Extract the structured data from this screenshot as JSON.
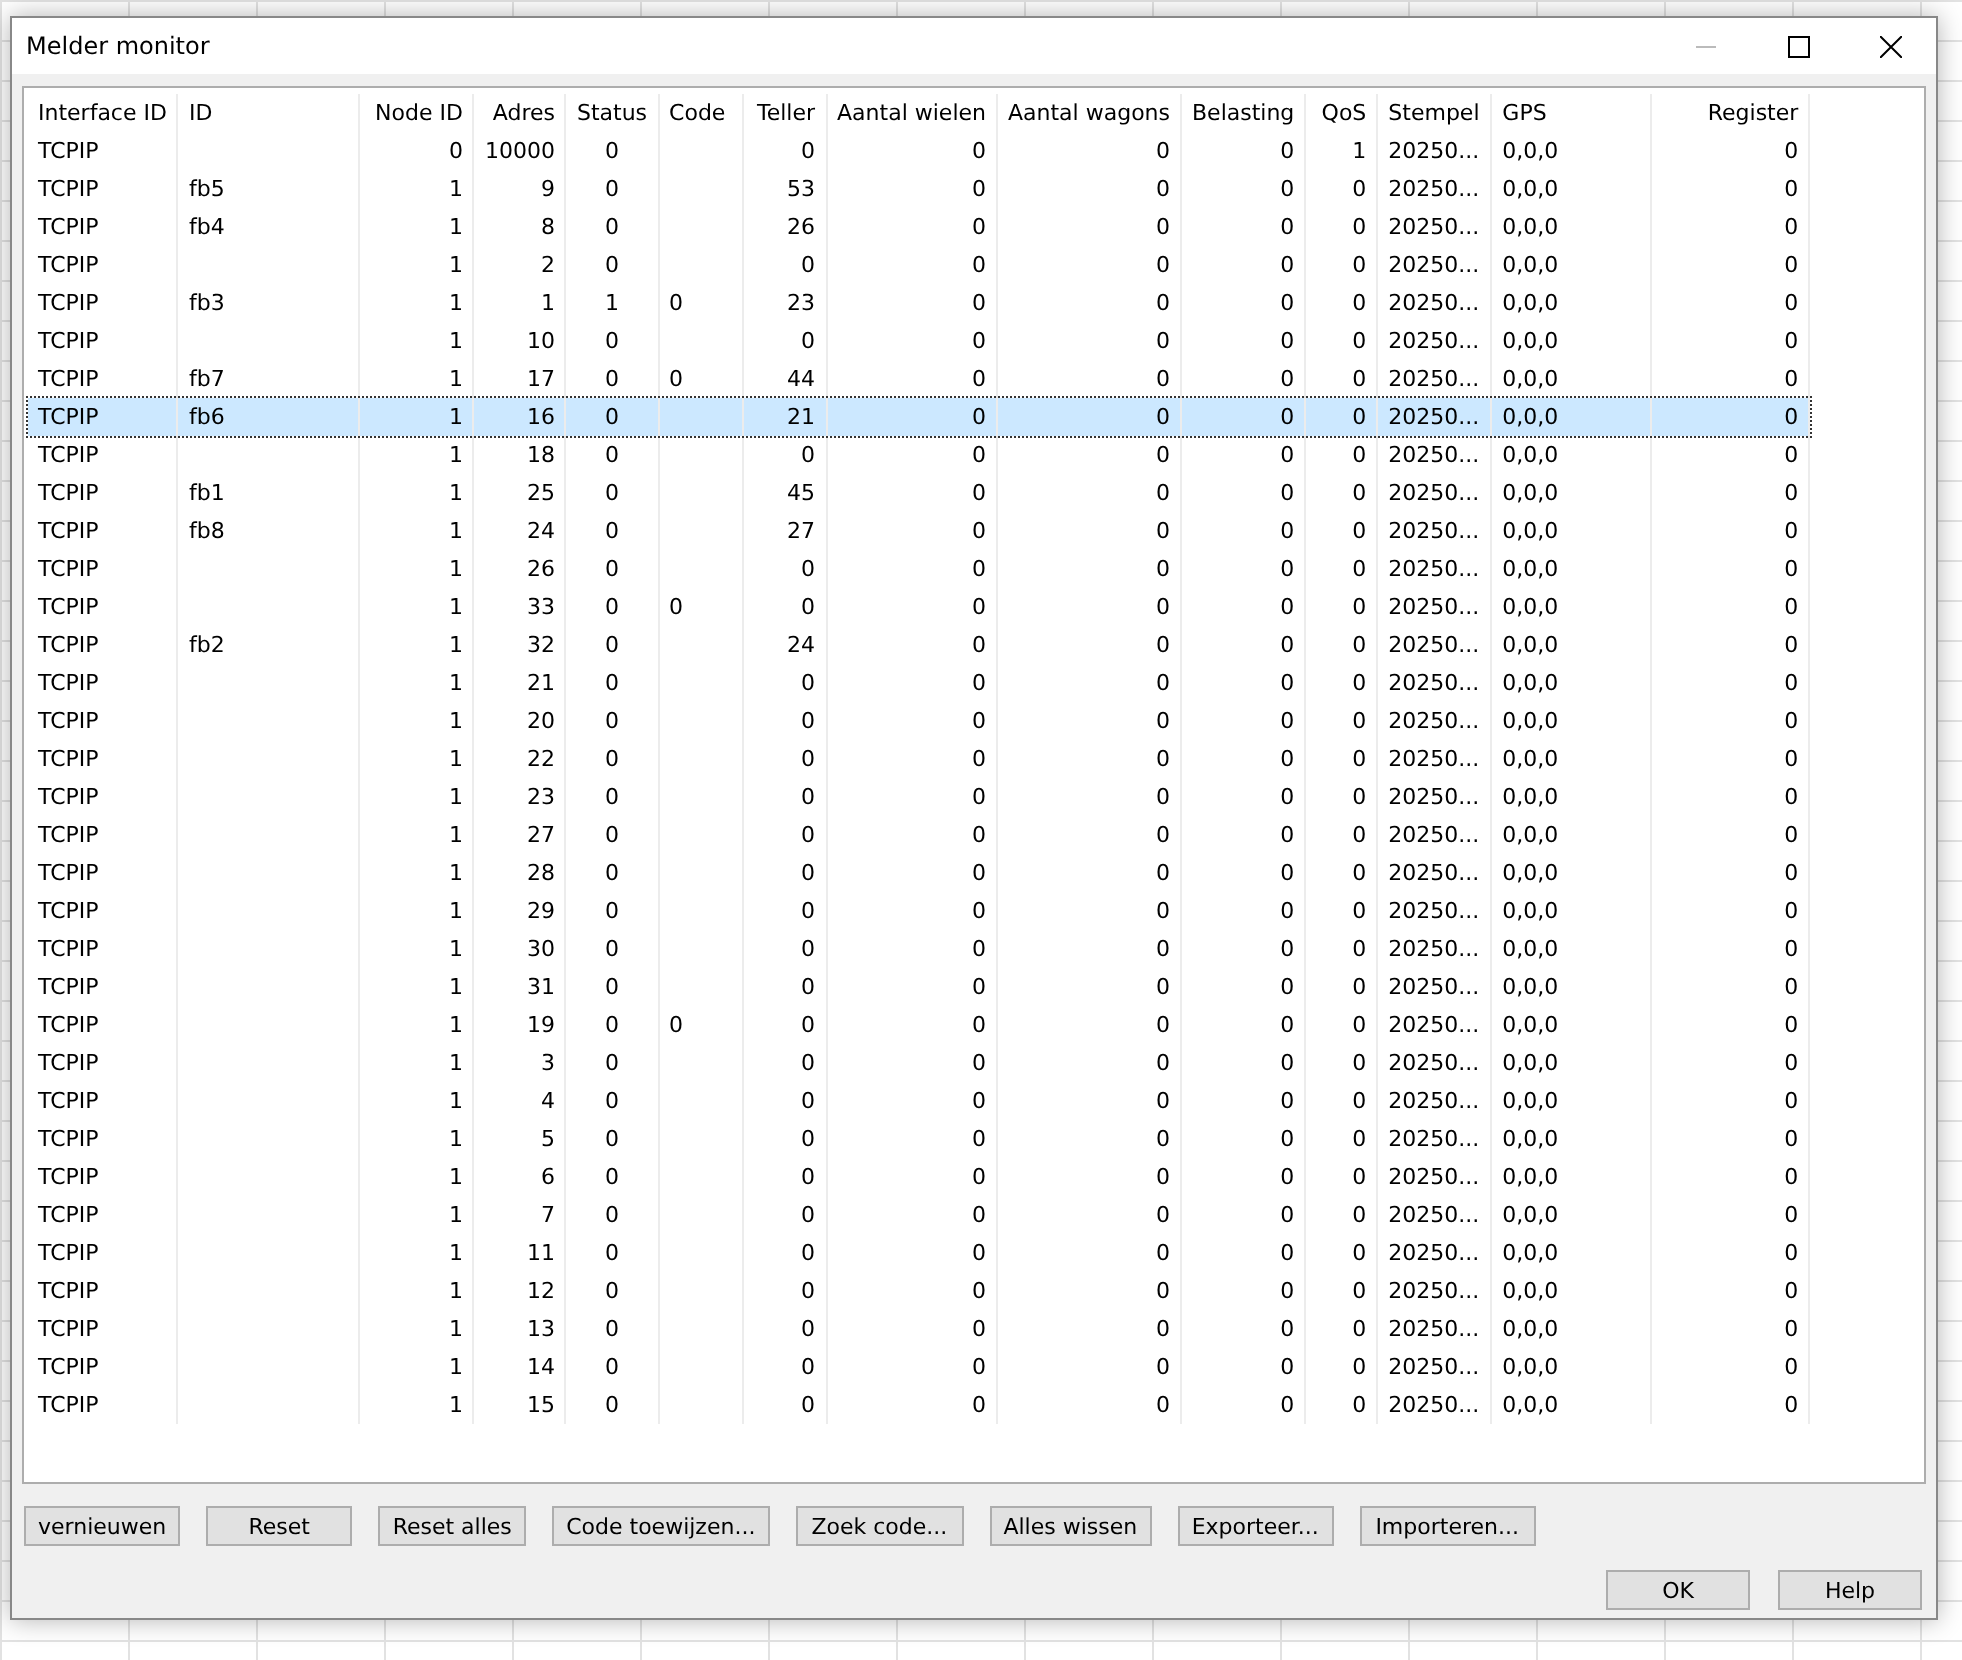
{
  "window": {
    "title": "Melder monitor"
  },
  "table": {
    "columns": [
      "Interface ID",
      "ID",
      "Node ID",
      "Adres",
      "Status",
      "Code",
      "Teller",
      "Aantal wielen",
      "Aantal wagons",
      "Belasting",
      "QoS",
      "Stempel",
      "GPS",
      "Register"
    ],
    "rows": [
      {
        "selected": false,
        "cells": [
          "TCPIP",
          null,
          "0",
          "10000",
          "0",
          null,
          "0",
          "0",
          "0",
          "0",
          "1",
          "20250...",
          "0,0,0",
          "0"
        ]
      },
      {
        "selected": false,
        "cells": [
          "TCPIP",
          "fb5",
          "1",
          "9",
          "0",
          null,
          "53",
          "0",
          "0",
          "0",
          "0",
          "20250...",
          "0,0,0",
          "0"
        ]
      },
      {
        "selected": false,
        "cells": [
          "TCPIP",
          "fb4",
          "1",
          "8",
          "0",
          null,
          "26",
          "0",
          "0",
          "0",
          "0",
          "20250...",
          "0,0,0",
          "0"
        ]
      },
      {
        "selected": false,
        "cells": [
          "TCPIP",
          null,
          "1",
          "2",
          "0",
          null,
          "0",
          "0",
          "0",
          "0",
          "0",
          "20250...",
          "0,0,0",
          "0"
        ]
      },
      {
        "selected": false,
        "cells": [
          "TCPIP",
          "fb3",
          "1",
          "1",
          "1",
          "0",
          "23",
          "0",
          "0",
          "0",
          "0",
          "20250...",
          "0,0,0",
          "0"
        ]
      },
      {
        "selected": false,
        "cells": [
          "TCPIP",
          null,
          "1",
          "10",
          "0",
          null,
          "0",
          "0",
          "0",
          "0",
          "0",
          "20250...",
          "0,0,0",
          "0"
        ]
      },
      {
        "selected": false,
        "cells": [
          "TCPIP",
          "fb7",
          "1",
          "17",
          "0",
          "0",
          "44",
          "0",
          "0",
          "0",
          "0",
          "20250...",
          "0,0,0",
          "0"
        ]
      },
      {
        "selected": true,
        "cells": [
          "TCPIP",
          "fb6",
          "1",
          "16",
          "0",
          null,
          "21",
          "0",
          "0",
          "0",
          "0",
          "20250...",
          "0,0,0",
          "0"
        ]
      },
      {
        "selected": false,
        "cells": [
          "TCPIP",
          null,
          "1",
          "18",
          "0",
          null,
          "0",
          "0",
          "0",
          "0",
          "0",
          "20250...",
          "0,0,0",
          "0"
        ]
      },
      {
        "selected": false,
        "cells": [
          "TCPIP",
          "fb1",
          "1",
          "25",
          "0",
          null,
          "45",
          "0",
          "0",
          "0",
          "0",
          "20250...",
          "0,0,0",
          "0"
        ]
      },
      {
        "selected": false,
        "cells": [
          "TCPIP",
          "fb8",
          "1",
          "24",
          "0",
          null,
          "27",
          "0",
          "0",
          "0",
          "0",
          "20250...",
          "0,0,0",
          "0"
        ]
      },
      {
        "selected": false,
        "cells": [
          "TCPIP",
          null,
          "1",
          "26",
          "0",
          null,
          "0",
          "0",
          "0",
          "0",
          "0",
          "20250...",
          "0,0,0",
          "0"
        ]
      },
      {
        "selected": false,
        "cells": [
          "TCPIP",
          null,
          "1",
          "33",
          "0",
          "0",
          "0",
          "0",
          "0",
          "0",
          "0",
          "20250...",
          "0,0,0",
          "0"
        ]
      },
      {
        "selected": false,
        "cells": [
          "TCPIP",
          "fb2",
          "1",
          "32",
          "0",
          null,
          "24",
          "0",
          "0",
          "0",
          "0",
          "20250...",
          "0,0,0",
          "0"
        ]
      },
      {
        "selected": false,
        "cells": [
          "TCPIP",
          null,
          "1",
          "21",
          "0",
          null,
          "0",
          "0",
          "0",
          "0",
          "0",
          "20250...",
          "0,0,0",
          "0"
        ]
      },
      {
        "selected": false,
        "cells": [
          "TCPIP",
          null,
          "1",
          "20",
          "0",
          null,
          "0",
          "0",
          "0",
          "0",
          "0",
          "20250...",
          "0,0,0",
          "0"
        ]
      },
      {
        "selected": false,
        "cells": [
          "TCPIP",
          null,
          "1",
          "22",
          "0",
          null,
          "0",
          "0",
          "0",
          "0",
          "0",
          "20250...",
          "0,0,0",
          "0"
        ]
      },
      {
        "selected": false,
        "cells": [
          "TCPIP",
          null,
          "1",
          "23",
          "0",
          null,
          "0",
          "0",
          "0",
          "0",
          "0",
          "20250...",
          "0,0,0",
          "0"
        ]
      },
      {
        "selected": false,
        "cells": [
          "TCPIP",
          null,
          "1",
          "27",
          "0",
          null,
          "0",
          "0",
          "0",
          "0",
          "0",
          "20250...",
          "0,0,0",
          "0"
        ]
      },
      {
        "selected": false,
        "cells": [
          "TCPIP",
          null,
          "1",
          "28",
          "0",
          null,
          "0",
          "0",
          "0",
          "0",
          "0",
          "20250...",
          "0,0,0",
          "0"
        ]
      },
      {
        "selected": false,
        "cells": [
          "TCPIP",
          null,
          "1",
          "29",
          "0",
          null,
          "0",
          "0",
          "0",
          "0",
          "0",
          "20250...",
          "0,0,0",
          "0"
        ]
      },
      {
        "selected": false,
        "cells": [
          "TCPIP",
          null,
          "1",
          "30",
          "0",
          null,
          "0",
          "0",
          "0",
          "0",
          "0",
          "20250...",
          "0,0,0",
          "0"
        ]
      },
      {
        "selected": false,
        "cells": [
          "TCPIP",
          null,
          "1",
          "31",
          "0",
          null,
          "0",
          "0",
          "0",
          "0",
          "0",
          "20250...",
          "0,0,0",
          "0"
        ]
      },
      {
        "selected": false,
        "cells": [
          "TCPIP",
          null,
          "1",
          "19",
          "0",
          "0",
          "0",
          "0",
          "0",
          "0",
          "0",
          "20250...",
          "0,0,0",
          "0"
        ]
      },
      {
        "selected": false,
        "cells": [
          "TCPIP",
          null,
          "1",
          "3",
          "0",
          null,
          "0",
          "0",
          "0",
          "0",
          "0",
          "20250...",
          "0,0,0",
          "0"
        ]
      },
      {
        "selected": false,
        "cells": [
          "TCPIP",
          null,
          "1",
          "4",
          "0",
          null,
          "0",
          "0",
          "0",
          "0",
          "0",
          "20250...",
          "0,0,0",
          "0"
        ]
      },
      {
        "selected": false,
        "cells": [
          "TCPIP",
          null,
          "1",
          "5",
          "0",
          null,
          "0",
          "0",
          "0",
          "0",
          "0",
          "20250...",
          "0,0,0",
          "0"
        ]
      },
      {
        "selected": false,
        "cells": [
          "TCPIP",
          null,
          "1",
          "6",
          "0",
          null,
          "0",
          "0",
          "0",
          "0",
          "0",
          "20250...",
          "0,0,0",
          "0"
        ]
      },
      {
        "selected": false,
        "cells": [
          "TCPIP",
          null,
          "1",
          "7",
          "0",
          null,
          "0",
          "0",
          "0",
          "0",
          "0",
          "20250...",
          "0,0,0",
          "0"
        ]
      },
      {
        "selected": false,
        "cells": [
          "TCPIP",
          null,
          "1",
          "11",
          "0",
          null,
          "0",
          "0",
          "0",
          "0",
          "0",
          "20250...",
          "0,0,0",
          "0"
        ]
      },
      {
        "selected": false,
        "cells": [
          "TCPIP",
          null,
          "1",
          "12",
          "0",
          null,
          "0",
          "0",
          "0",
          "0",
          "0",
          "20250...",
          "0,0,0",
          "0"
        ]
      },
      {
        "selected": false,
        "cells": [
          "TCPIP",
          null,
          "1",
          "13",
          "0",
          null,
          "0",
          "0",
          "0",
          "0",
          "0",
          "20250...",
          "0,0,0",
          "0"
        ]
      },
      {
        "selected": false,
        "cells": [
          "TCPIP",
          null,
          "1",
          "14",
          "0",
          null,
          "0",
          "0",
          "0",
          "0",
          "0",
          "20250...",
          "0,0,0",
          "0"
        ]
      },
      {
        "selected": false,
        "cells": [
          "TCPIP",
          null,
          "1",
          "15",
          "0",
          null,
          "0",
          "0",
          "0",
          "0",
          "0",
          "20250...",
          "0,0,0",
          "0"
        ]
      }
    ]
  },
  "action_buttons": [
    "vernieuwen",
    "Reset",
    "Reset alles",
    "Code toewijzen...",
    "Zoek code...",
    "Alles wissen",
    "Exporteer...",
    "Importeren..."
  ],
  "dialog_buttons": [
    "OK",
    "Help"
  ]
}
